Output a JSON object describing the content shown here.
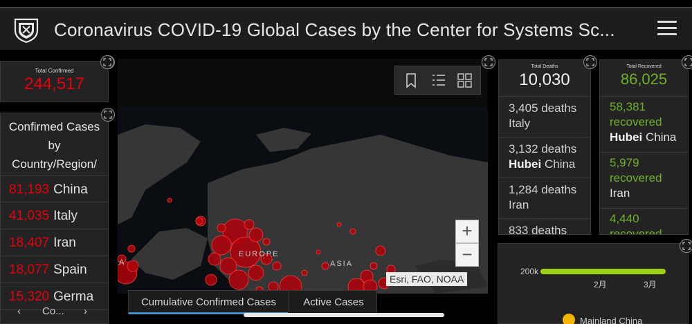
{
  "header": {
    "title": "Coronavirus COVID-19 Global Cases by the Center for Systems Sc..."
  },
  "total_confirmed": {
    "label": "Total Confirmed",
    "value": "244,517"
  },
  "confirmed_by_country": {
    "heading": "Confirmed Cases by Country/Region/",
    "rows": [
      {
        "count": "81,193",
        "name": "China"
      },
      {
        "count": "41,035",
        "name": "Italy"
      },
      {
        "count": "18,407",
        "name": "Iran"
      },
      {
        "count": "18,077",
        "name": "Spain"
      },
      {
        "count": "15,320",
        "name": "Germa"
      }
    ],
    "pager_label": "Co..."
  },
  "map": {
    "labels": {
      "europe": "EUROPE",
      "asia": "ASIA",
      "left": "A"
    },
    "attribution": "Esri, FAO, NOAA",
    "zoom_in": "+",
    "zoom_out": "−"
  },
  "map_tabs": [
    "Cumulative Confirmed Cases",
    "Active Cases"
  ],
  "total_deaths": {
    "label": "Total Deaths",
    "value": "10,030",
    "rows": [
      {
        "line1": "3,405 deaths",
        "bold": "",
        "line2": "Italy"
      },
      {
        "line1": "3,132 deaths",
        "bold": "Hubei",
        "line2": " China"
      },
      {
        "line1": "1,284 deaths",
        "bold": "",
        "line2": "Iran"
      },
      {
        "line1": "833 deaths",
        "bold": "",
        "line2": ""
      }
    ]
  },
  "total_recovered": {
    "label": "Total Recovered",
    "value": "86,025",
    "rows": [
      {
        "count": "58,381",
        "word": "recovered",
        "bold": "Hubei",
        "place": " China"
      },
      {
        "count": "5,979",
        "word": "recovered",
        "bold": "",
        "place": "Iran"
      },
      {
        "count": "4,440",
        "word": "recovered",
        "bold": "",
        "place": ""
      }
    ]
  },
  "trend_chart": {
    "y_tick": "200k",
    "x_ticks": [
      "2月",
      "3月"
    ],
    "legend": "Mainland China"
  },
  "colors": {
    "accent_red": "#e6000a",
    "accent_green": "#6fb025"
  }
}
